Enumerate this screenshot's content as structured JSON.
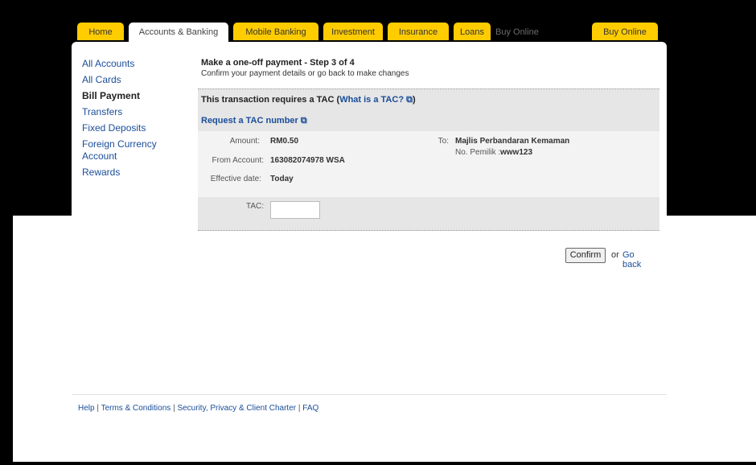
{
  "tabs": [
    {
      "label": "Home"
    },
    {
      "label": "Accounts & Banking"
    },
    {
      "label": "Mobile Banking"
    },
    {
      "label": "Investment"
    },
    {
      "label": "Insurance"
    },
    {
      "label": "Loans"
    },
    {
      "label": "Buy Online"
    },
    {
      "label": "Buy Online"
    }
  ],
  "sidebar": {
    "items": [
      {
        "label": "All Accounts"
      },
      {
        "label": "All Cards"
      },
      {
        "label": "Bill Payment"
      },
      {
        "label": "Transfers"
      },
      {
        "label": "Fixed Deposits"
      },
      {
        "label": "Foreign Currency Account"
      },
      {
        "label": "Rewards"
      }
    ]
  },
  "main": {
    "title": "Make a one-off payment - Step 3 of 4",
    "subtitle": "Confirm your payment details or go back to make changes",
    "tac_notice": "This transaction requires a TAC",
    "what_is_tac": "What is a TAC?",
    "request_tac": "Request a TAC number",
    "amount_label": "Amount:",
    "amount_value": "RM0.50",
    "from_label": "From Account:",
    "from_value": "163082074978 WSA",
    "date_label": "Effective date:",
    "date_value": "Today",
    "to_label": "To:",
    "to_value": "Majlis Perbandaran Kemaman",
    "pemilik_label": "No. Pemilik :",
    "pemilik_value": "www123",
    "tac_label": "TAC:",
    "tac_value": ""
  },
  "actions": {
    "confirm": "Confirm",
    "or": "or",
    "go_back": "Go back"
  },
  "footer": {
    "help": "Help",
    "terms": "Terms & Conditions",
    "security": "Security, Privacy & Client Charter",
    "faq": "FAQ",
    "sep": "|"
  }
}
